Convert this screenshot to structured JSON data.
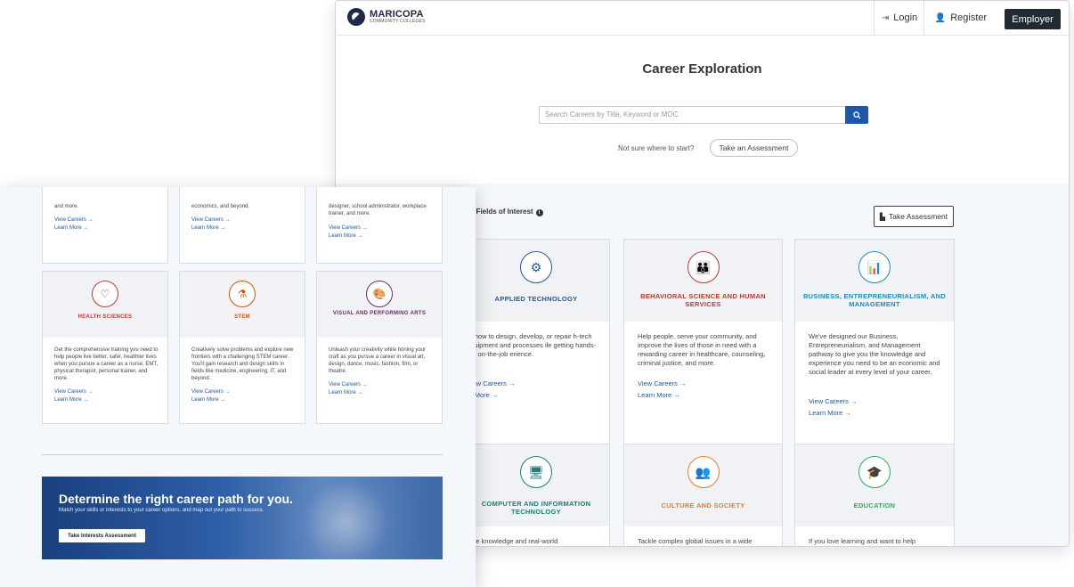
{
  "header": {
    "logo_name": "MARICOPA",
    "logo_sub": "COMMUNITY COLLEGES",
    "login": "Login",
    "register": "Register",
    "employer": "Employer"
  },
  "hero": {
    "title": "Career Exploration",
    "search_placeholder": "Search Careers by Title, Keyword or MOC",
    "not_sure": "Not sure where to start?",
    "assessment_pill": "Take an Assessment"
  },
  "fields": {
    "heading": "by Fields of Interest",
    "take_assessment": "Take Assessment",
    "cards": [
      {
        "title": "APPLIED TECHNOLOGY",
        "color": "#1f56a8",
        "icon": "gears-icon",
        "body": "rn how to design, develop, or repair h-tech equipment and processes ile getting hands-on, on-the-job erience.",
        "view": "View Careers →",
        "learn": "rn More →"
      },
      {
        "title": "BEHAVIORAL SCIENCE AND HUMAN SERVICES",
        "color": "#c0392b",
        "icon": "people-icon",
        "body": "Help people, serve your community, and improve the lives of those in need with a rewarding career in healthcare, counseling, criminal justice, and more.",
        "view": "View Careers →",
        "learn": "Learn More →"
      },
      {
        "title": "BUSINESS, ENTREPRENEURIALISM, AND MANAGEMENT",
        "color": "#1e8bc3",
        "icon": "presentation-icon",
        "body": "We've designed our Business, Entrepreneurialism, and Management pathway to give you the knowledge and experience you need to be an economic and social leader at every level of your career.",
        "view": "View Careers →",
        "learn": "Learn More →"
      },
      {
        "title": "COMPUTER AND INFORMATION TECHNOLOGY",
        "color": "#1a7f7a",
        "icon": "computer-icon",
        "body": "t the knowledge and real-world",
        "view": "",
        "learn": ""
      },
      {
        "title": "CULTURE AND SOCIETY",
        "color": "#e67e22",
        "icon": "crowd-icon",
        "body": "Tackle complex global issues in a wide",
        "view": "",
        "learn": ""
      },
      {
        "title": "EDUCATION",
        "color": "#27ae60",
        "icon": "graduation-cap-icon",
        "body": "If you love learning and want to help",
        "view": "",
        "learn": ""
      }
    ]
  },
  "front": {
    "top_cards": [
      {
        "body": "and more.",
        "view": "View Careers →",
        "learn": "Learn More →"
      },
      {
        "body": "economics, and beyond.",
        "view": "View Careers →",
        "learn": "Learn More →"
      },
      {
        "body": "designer, school administrator, workplace trainer, and more.",
        "view": "View Careers →",
        "learn": "Learn More →"
      }
    ],
    "cards": [
      {
        "title": "HEALTH SCIENCES",
        "color": "#c0392b",
        "icon": "heart-pulse-icon",
        "body": "Get the comprehensive training you need to help people live better, safer, healthier lives when you pursue a career as a nurse, EMT, physical therapist, personal trainer, and more.",
        "view": "View Careers →",
        "learn": "Learn More →"
      },
      {
        "title": "STEM",
        "color": "#d35400",
        "icon": "flask-icon",
        "body": "Creatively solve problems and explore new frontiers with a challenging STEM career. You'll gain research and design skills in fields like medicine, engineering, IT, and beyond.",
        "view": "View Careers →",
        "learn": "Learn More →"
      },
      {
        "title": "VISUAL AND PERFORMING ARTS",
        "color": "#6c2a6a",
        "icon": "palette-icon",
        "body": "Unleash your creativity while honing your craft as you pursue a career in visual art, design, dance, music, fashion, film, or theatre.",
        "view": "View Careers →",
        "learn": "Learn More →"
      }
    ],
    "banner": {
      "title": "Determine the right career path for you.",
      "subtitle": "Match your skills or interests to your career options, and map out your path to success.",
      "button": "Take Interests Assessment"
    }
  }
}
